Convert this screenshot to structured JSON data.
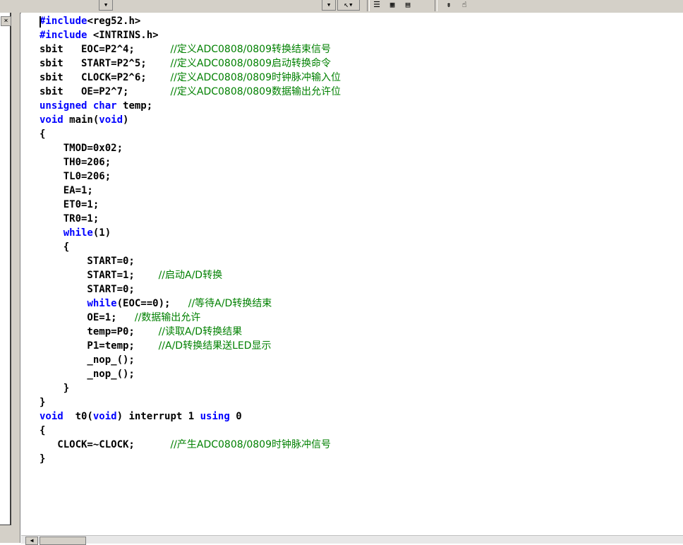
{
  "toolbar": {
    "icons": [
      "dropdown-arrow-icon",
      "pointer-icon",
      "books-icon",
      "window-icon",
      "disk-icon",
      "step-icon",
      "hand-icon"
    ]
  },
  "gutter": {
    "close_label": "×"
  },
  "code": {
    "l1a": "#include",
    "l1b": "<reg52.h>",
    "l2a": "#include",
    "l2b": " <INTRINS.h>",
    "l3a": "sbit   EOC=P2^4;      ",
    "l3b": "//定义ADC0808/0809转换结束信号",
    "l4a": "sbit   START=P2^5;    ",
    "l4b": "//定义ADC0808/0809启动转换命令",
    "l5a": "sbit   CLOCK=P2^6;    ",
    "l5b": "//定义ADC0808/0809时钟脉冲输入位",
    "l6a": "sbit   OE=P2^7;       ",
    "l6b": "//定义ADC0808/0809数据输出允许位",
    "l7a": "unsigned",
    "l7b": " ",
    "l7c": "char",
    "l7d": " temp;",
    "l8a": "void",
    "l8b": " main(",
    "l8c": "void",
    "l8d": ")",
    "l9": "{",
    "l10": "    TMOD=0x02;",
    "l11": "    TH0=206;",
    "l12": "    TL0=206;",
    "l13": "    EA=1;",
    "l14": "    ET0=1;",
    "l15": "    TR0=1;",
    "l16a": "    ",
    "l16b": "while",
    "l16c": "(1)",
    "l17": "    {",
    "l18": "        START=0;",
    "l19a": "        START=1;    ",
    "l19b": "//启动A/D转换",
    "l20": "        START=0;",
    "l21a": "        ",
    "l21b": "while",
    "l21c": "(EOC==0);   ",
    "l21d": "//等待A/D转换结束",
    "l22a": "        OE=1;   ",
    "l22b": "//数据输出允许",
    "l23a": "        temp=P0;    ",
    "l23b": "//读取A/D转换结果",
    "l24a": "        P1=temp;    ",
    "l24b": "//A/D转换结果送LED显示",
    "l25": "        _nop_();",
    "l26": "        _nop_();",
    "l27": "    }",
    "l28": "}",
    "l29a": "void",
    "l29b": "  t0(",
    "l29c": "void",
    "l29d": ") interrupt 1 ",
    "l29e": "using",
    "l29f": " 0",
    "l30": "{",
    "l31a": "   CLOCK=~CLOCK;      ",
    "l31b": "//产生ADC0808/0809时钟脉冲信号",
    "l32": "}"
  }
}
